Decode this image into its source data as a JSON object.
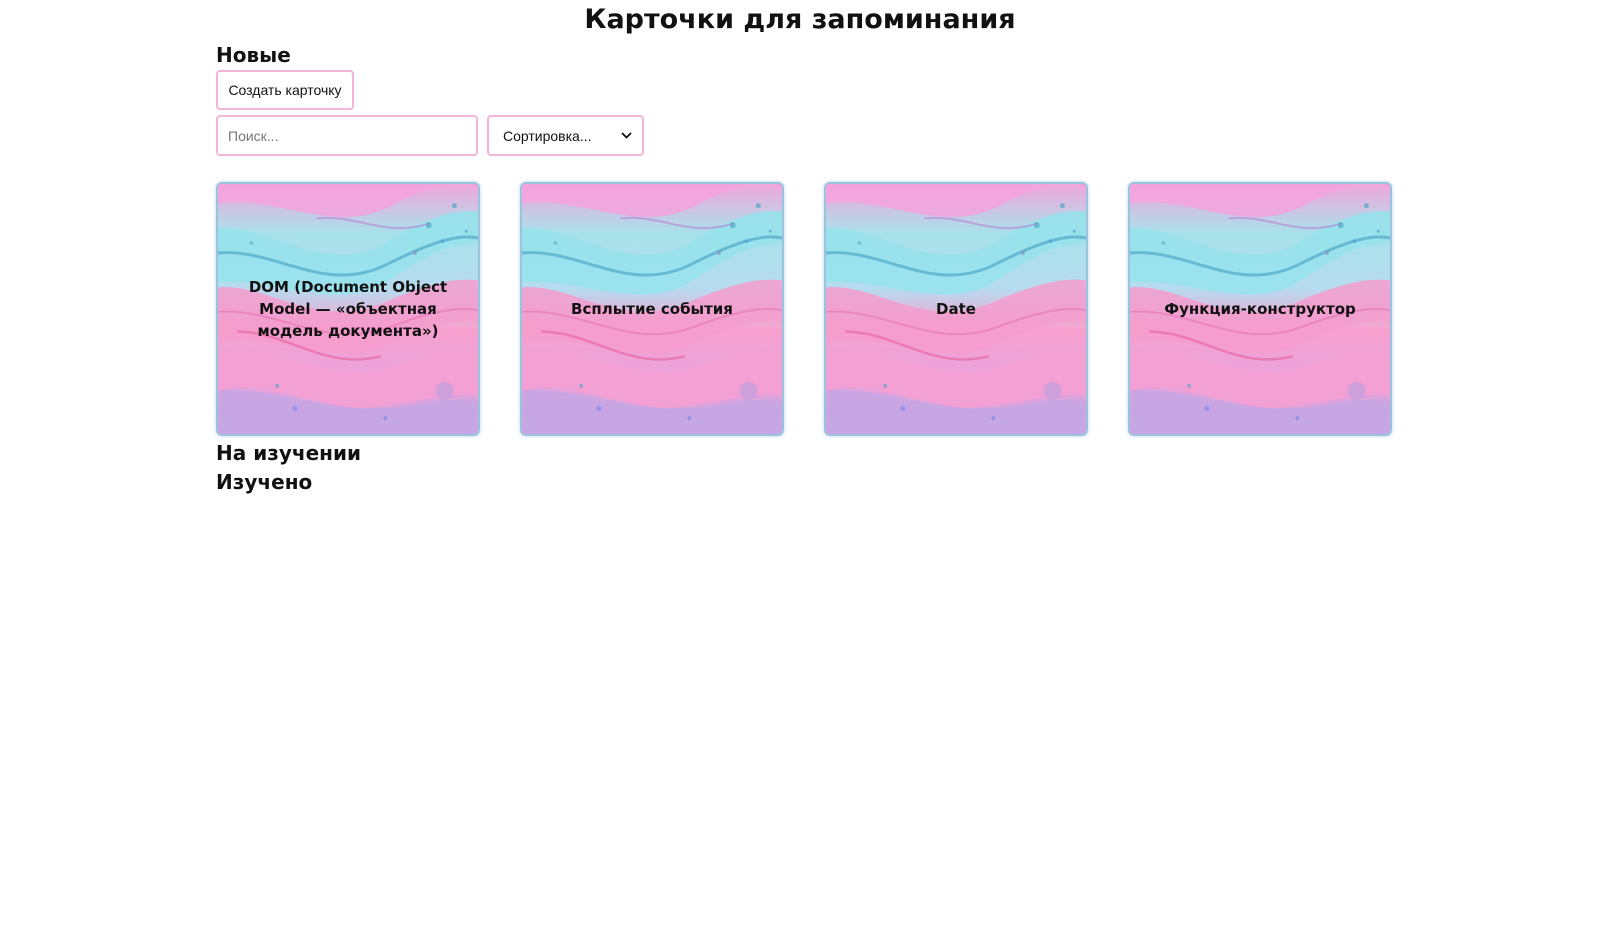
{
  "page": {
    "title": "Карточки для запоминания"
  },
  "sections": {
    "new": "Новые",
    "learning": "На изучении",
    "learned": "Изучено"
  },
  "controls": {
    "create_button": "Создать карточку",
    "search_placeholder": "Поиск...",
    "sort_selected": "Сортировка..."
  },
  "cards": [
    {
      "title": "DOM (Document Object Model — «объектная модель документа»)"
    },
    {
      "title": "Всплытие события"
    },
    {
      "title": "Date"
    },
    {
      "title": "Функция-конструктор"
    }
  ],
  "colors": {
    "control_border": "#f3b6d6",
    "card_border": "#9ac3dc",
    "marble_pink": "#f59ac9",
    "marble_cyan": "#9fe1ea",
    "marble_purple": "#c49ddd"
  }
}
